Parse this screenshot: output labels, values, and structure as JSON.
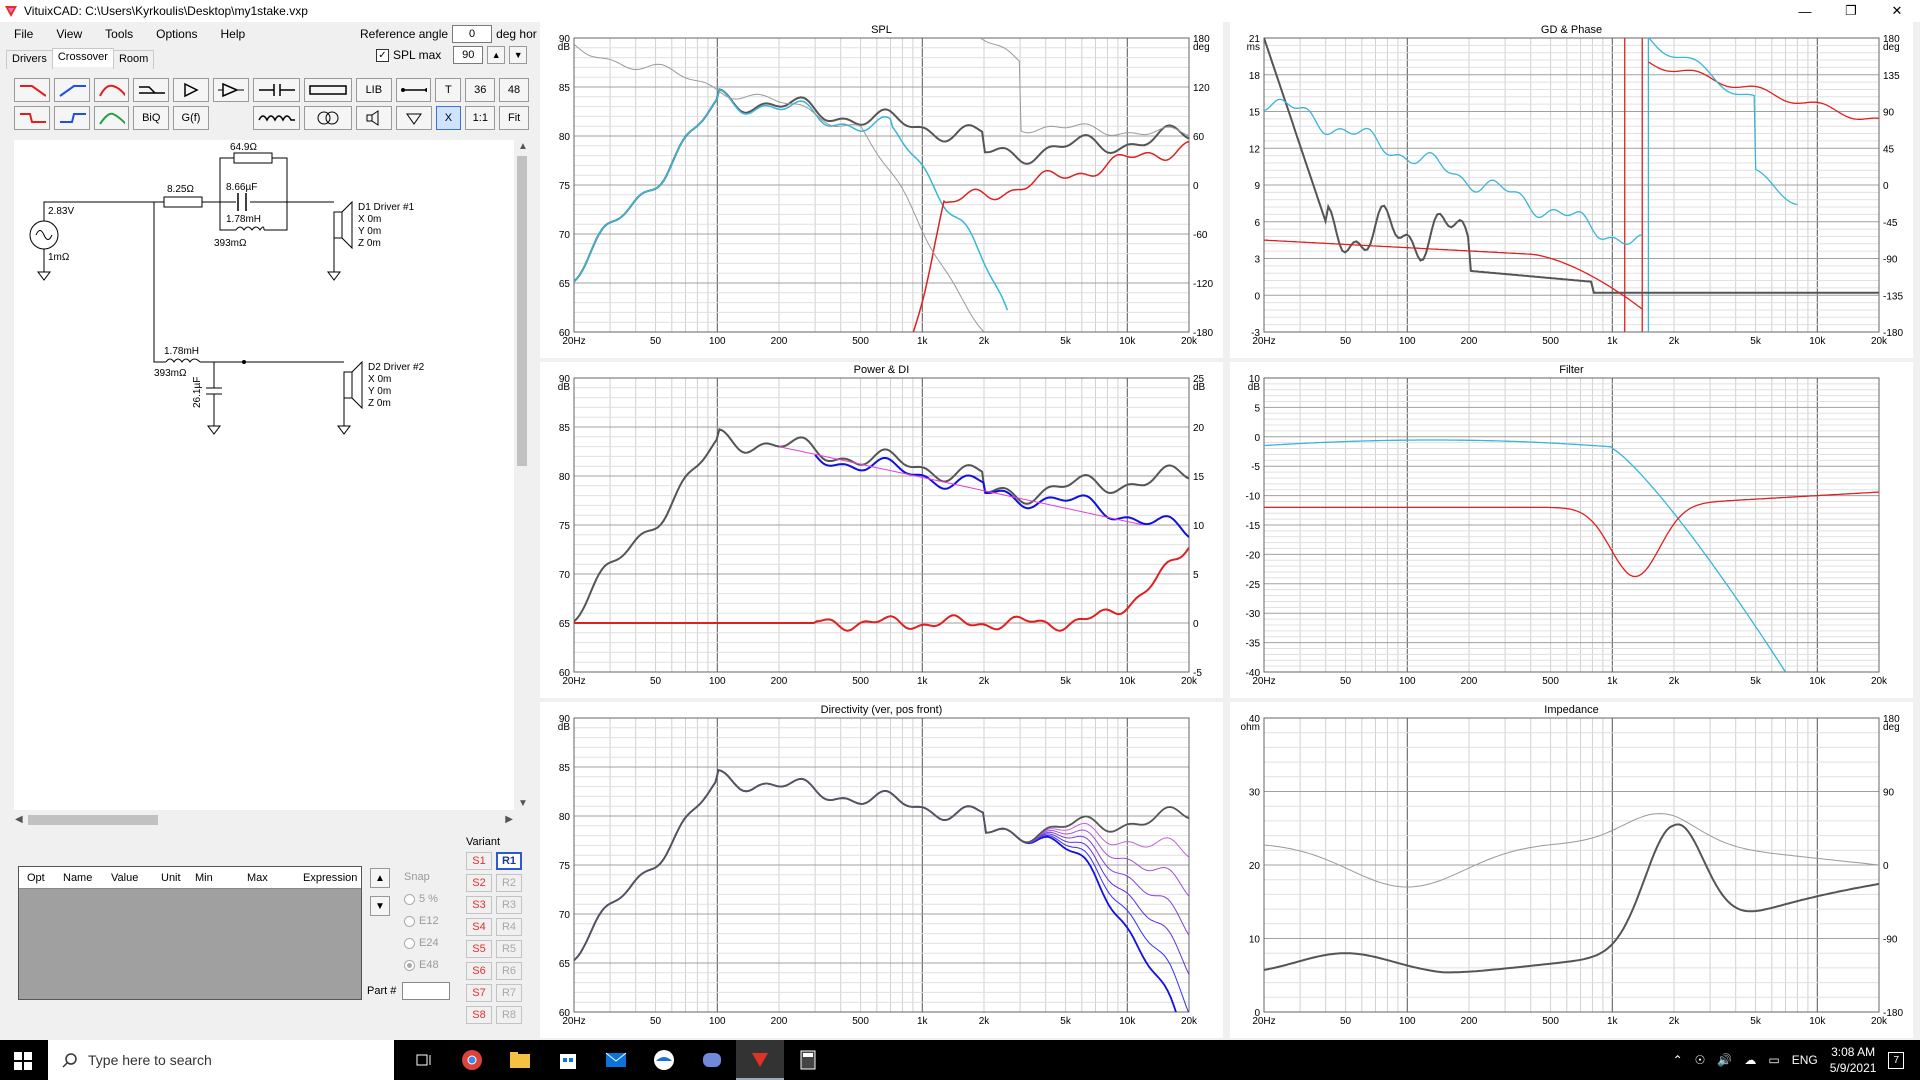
{
  "window": {
    "title": "VituixCAD: C:\\Users\\Kyrkoulis\\Desktop\\my1stake.vxp"
  },
  "menu": [
    "File",
    "View",
    "Tools",
    "Options",
    "Help"
  ],
  "reference": {
    "label": "Reference angle",
    "value": "0",
    "unit": "deg hor"
  },
  "splmax": {
    "label": "SPL max",
    "value": "90",
    "checked": true
  },
  "tabs": [
    "Drivers",
    "Crossover",
    "Room"
  ],
  "toolbar": {
    "row1_labels": [
      "LIB",
      "T",
      "36",
      "48"
    ],
    "row2_labels": [
      "BiQ",
      "G(f)",
      "X",
      "1:1",
      "Fit"
    ]
  },
  "schematic": {
    "source_v": "2.83V",
    "source_r": "1mΩ",
    "r_series": "8.25Ω",
    "r_top": "64.9Ω",
    "c_par": "8.66µF",
    "l_par": "1.78mH",
    "l_par_r": "393mΩ",
    "driver1": {
      "name": "D1 Driver #1",
      "x": "X 0m",
      "y": "Y 0m",
      "z": "Z 0m"
    },
    "l2": "1.78mH",
    "l2_r": "393mΩ",
    "c2": "26.1µF",
    "driver2": {
      "name": "D2 Driver #2",
      "x": "X 0m",
      "y": "Y 0m",
      "z": "Z 0m"
    }
  },
  "param_table": {
    "headers": [
      "Opt",
      "Name",
      "Value",
      "Unit",
      "Min",
      "Max",
      "Expression"
    ]
  },
  "snap": {
    "label": "Snap",
    "options": [
      "5 %",
      "E12",
      "E24",
      "E48"
    ],
    "selected": "E48"
  },
  "part": {
    "label": "Part #"
  },
  "variant": {
    "label": "Variant",
    "s": [
      "S1",
      "S2",
      "S3",
      "S4",
      "S5",
      "S6",
      "S7",
      "S8"
    ],
    "r": [
      "R1",
      "R2",
      "R3",
      "R4",
      "R5",
      "R6",
      "R7",
      "R8"
    ]
  },
  "plots": [
    {
      "title": "SPL",
      "ylabel": "dB",
      "yticks": [
        "90",
        "85",
        "80",
        "75",
        "70",
        "65",
        "60"
      ],
      "y2label": "deg",
      "y2ticks": [
        "180",
        "120",
        "60",
        "0",
        "-60",
        "-120",
        "-180"
      ]
    },
    {
      "title": "GD & Phase",
      "ylabel": "ms",
      "yticks": [
        "21",
        "18",
        "15",
        "12",
        "9",
        "6",
        "3",
        "0",
        "-3"
      ],
      "y2label": "deg",
      "y2ticks": [
        "180",
        "135",
        "90",
        "45",
        "0",
        "-45",
        "-90",
        "-135",
        "-180"
      ]
    },
    {
      "title": "Power & DI",
      "ylabel": "dB",
      "yticks": [
        "90",
        "85",
        "80",
        "75",
        "70",
        "65",
        "60"
      ],
      "y2label": "dB",
      "y2ticks": [
        "25",
        "20",
        "15",
        "10",
        "5",
        "0",
        "-5"
      ]
    },
    {
      "title": "Filter",
      "ylabel": "dB",
      "yticks": [
        "10",
        "5",
        "0",
        "-5",
        "-10",
        "-15",
        "-20",
        "-25",
        "-30",
        "-35",
        "-40"
      ],
      "y2label": "",
      "y2ticks": []
    },
    {
      "title": "Directivity (ver, pos front)",
      "ylabel": "dB",
      "yticks": [
        "90",
        "85",
        "80",
        "75",
        "70",
        "65",
        "60"
      ],
      "y2label": "",
      "y2ticks": []
    },
    {
      "title": "Impedance",
      "ylabel": "ohm",
      "yticks": [
        "40",
        "30",
        "20",
        "10",
        "0"
      ],
      "y2label": "deg",
      "y2ticks": [
        "180",
        "90",
        "0",
        "-90",
        "-180"
      ]
    }
  ],
  "xticks": [
    "20Hz",
    "50",
    "100",
    "200",
    "500",
    "1k",
    "2k",
    "5k",
    "10k",
    "20k"
  ],
  "taskbar": {
    "search_placeholder": "Type here to search",
    "lang": "ENG",
    "time": "3:08 AM",
    "date": "5/9/2021",
    "notif": "7"
  }
}
